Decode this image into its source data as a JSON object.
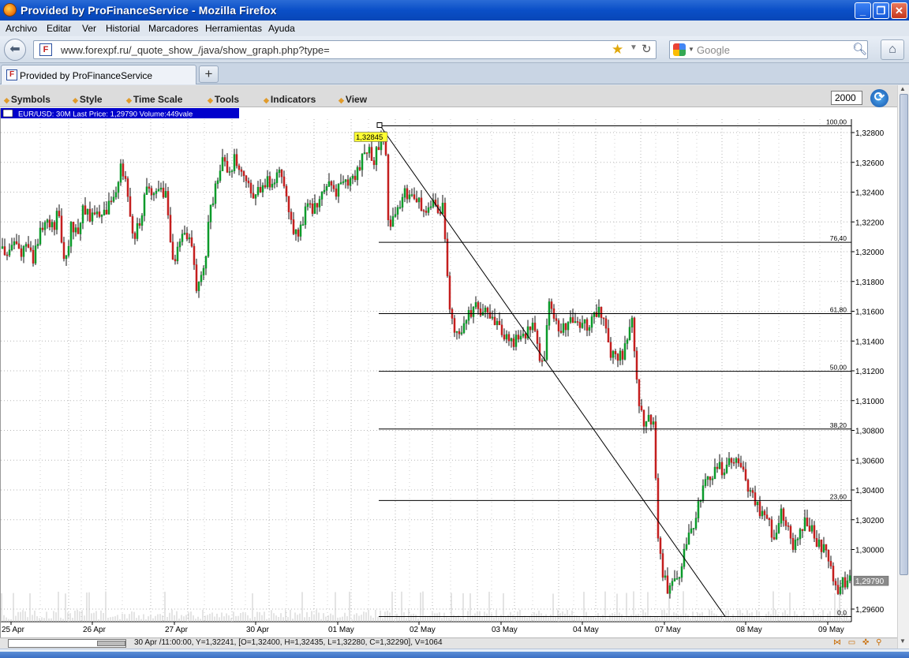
{
  "window": {
    "title": "Provided by ProFinanceService - Mozilla Firefox",
    "buttons": {
      "minimize": "_",
      "maximize": "❐",
      "close": "✕"
    }
  },
  "menubar": [
    "Archivo",
    "Editar",
    "Ver",
    "Historial",
    "Marcadores",
    "Herramientas",
    "Ayuda"
  ],
  "navbar": {
    "url": "www.forexpf.ru/_quote_show_/java/show_graph.php?type=",
    "search_placeholder": "Google",
    "site_icon_letter": "F"
  },
  "tabs": [
    {
      "label": "Provided by ProFinanceService",
      "icon": "F"
    }
  ],
  "newtab_label": "+",
  "toolbar": {
    "menus": [
      "Symbols",
      "Style",
      "Time Scale",
      "Tools",
      "Indicators",
      "View"
    ],
    "zoom_value": "2000"
  },
  "status": {
    "text": "30 Apr /11:00:00, Y=1,32241, [O=1,32400, H=1,32435, L=1,32280, C=1,32290], V=1064",
    "icons": "⋈ ▭ ✜ ⚲"
  },
  "chart_data": {
    "type": "candlestick",
    "header": "EUR/USD: 30M Last Price: 1,29790 Volume:449vale",
    "ylim": [
      1.295,
      1.329
    ],
    "y_ticks": [
      "1,32800",
      "1,32600",
      "1,32400",
      "1,32200",
      "1,32000",
      "1,31800",
      "1,31600",
      "1,31400",
      "1,31200",
      "1,31000",
      "1,30800",
      "1,30600",
      "1,30400",
      "1,30200",
      "1,30000",
      "1,29600"
    ],
    "x_ticks": [
      "25 Apr",
      "26 Apr",
      "27 Apr",
      "30 Apr",
      "01 May",
      "02 May",
      "03 May",
      "04 May",
      "07 May",
      "08 May",
      "09 May"
    ],
    "last_price": "1,29790",
    "high_marker": "1,32845",
    "fibonacci": {
      "high": 1.32845,
      "low": 1.2955,
      "levels": [
        {
          "label": "100,00",
          "price": 1.32845
        },
        {
          "label": "76,40",
          "price": 1.32063
        },
        {
          "label": "61,80",
          "price": 1.31584
        },
        {
          "label": "50,00",
          "price": 1.31197
        },
        {
          "label": "38,20",
          "price": 1.30809
        },
        {
          "label": "23,60",
          "price": 1.30329
        },
        {
          "label": "0,0",
          "price": 1.2955
        }
      ]
    },
    "trendline": {
      "from": {
        "date": "01 May",
        "price": 1.32845
      },
      "to": {
        "date": "08 May",
        "price": 1.2955
      }
    },
    "price_path": [
      [
        0,
        1.3202
      ],
      [
        8,
        1.3197
      ],
      [
        16,
        1.3205
      ],
      [
        24,
        1.3199
      ],
      [
        32,
        1.3201
      ],
      [
        40,
        1.3195
      ],
      [
        48,
        1.3212
      ],
      [
        56,
        1.3221
      ],
      [
        64,
        1.3215
      ],
      [
        72,
        1.3225
      ],
      [
        80,
        1.3192
      ],
      [
        88,
        1.3218
      ],
      [
        96,
        1.3213
      ],
      [
        104,
        1.3228
      ],
      [
        112,
        1.3224
      ],
      [
        120,
        1.3232
      ],
      [
        128,
        1.3221
      ],
      [
        136,
        1.3231
      ],
      [
        144,
        1.3237
      ],
      [
        152,
        1.3258
      ],
      [
        160,
        1.3236
      ],
      [
        168,
        1.3211
      ],
      [
        176,
        1.322
      ],
      [
        184,
        1.3244
      ],
      [
        192,
        1.3233
      ],
      [
        200,
        1.3247
      ],
      [
        208,
        1.3238
      ],
      [
        216,
        1.319
      ],
      [
        224,
        1.32
      ],
      [
        232,
        1.3212
      ],
      [
        240,
        1.3206
      ],
      [
        248,
        1.3172
      ],
      [
        256,
        1.3186
      ],
      [
        264,
        1.3226
      ],
      [
        272,
        1.3246
      ],
      [
        280,
        1.3262
      ],
      [
        288,
        1.3252
      ],
      [
        296,
        1.3266
      ],
      [
        304,
        1.3251
      ],
      [
        312,
        1.3246
      ],
      [
        320,
        1.3239
      ],
      [
        328,
        1.3241
      ],
      [
        336,
        1.3248
      ],
      [
        344,
        1.3245
      ],
      [
        352,
        1.3258
      ],
      [
        360,
        1.3237
      ],
      [
        368,
        1.3218
      ],
      [
        376,
        1.3209
      ],
      [
        384,
        1.3226
      ],
      [
        392,
        1.3229
      ],
      [
        400,
        1.3233
      ],
      [
        408,
        1.3241
      ],
      [
        416,
        1.3244
      ],
      [
        424,
        1.3239
      ],
      [
        432,
        1.3244
      ],
      [
        440,
        1.3246
      ],
      [
        448,
        1.3249
      ],
      [
        456,
        1.3262
      ],
      [
        464,
        1.3272
      ],
      [
        472,
        1.3262
      ],
      [
        480,
        1.3276
      ],
      [
        486,
        1.3282
      ],
      [
        490,
        1.3222
      ],
      [
        496,
        1.3219
      ],
      [
        504,
        1.3228
      ],
      [
        512,
        1.324
      ],
      [
        520,
        1.3239
      ],
      [
        528,
        1.3238
      ],
      [
        536,
        1.3222
      ],
      [
        544,
        1.3231
      ],
      [
        552,
        1.3228
      ],
      [
        560,
        1.3232
      ],
      [
        566,
        1.317
      ],
      [
        572,
        1.315
      ],
      [
        578,
        1.314
      ],
      [
        584,
        1.3145
      ],
      [
        592,
        1.3158
      ],
      [
        600,
        1.3165
      ],
      [
        608,
        1.316
      ],
      [
        616,
        1.3158
      ],
      [
        624,
        1.3152
      ],
      [
        632,
        1.3148
      ],
      [
        640,
        1.3143
      ],
      [
        648,
        1.314
      ],
      [
        656,
        1.3142
      ],
      [
        664,
        1.3144
      ],
      [
        672,
        1.3153
      ],
      [
        680,
        1.3132
      ],
      [
        688,
        1.3125
      ],
      [
        694,
        1.317
      ],
      [
        700,
        1.3152
      ],
      [
        708,
        1.315
      ],
      [
        716,
        1.3152
      ],
      [
        724,
        1.3151
      ],
      [
        732,
        1.3153
      ],
      [
        740,
        1.315
      ],
      [
        748,
        1.3155
      ],
      [
        756,
        1.3162
      ],
      [
        764,
        1.315
      ],
      [
        772,
        1.313
      ],
      [
        780,
        1.3128
      ],
      [
        788,
        1.3132
      ],
      [
        794,
        1.314
      ],
      [
        798,
        1.3165
      ],
      [
        802,
        1.313
      ],
      [
        808,
        1.3095
      ],
      [
        814,
        1.3085
      ],
      [
        820,
        1.309
      ],
      [
        826,
        1.3082
      ],
      [
        832,
        1.3012
      ],
      [
        838,
        1.298
      ],
      [
        844,
        1.2975
      ],
      [
        852,
        1.2978
      ],
      [
        860,
        1.2985
      ],
      [
        868,
        1.3005
      ],
      [
        876,
        1.3015
      ],
      [
        884,
        1.3035
      ],
      [
        892,
        1.3045
      ],
      [
        900,
        1.3052
      ],
      [
        908,
        1.3056
      ],
      [
        916,
        1.3052
      ],
      [
        924,
        1.3058
      ],
      [
        932,
        1.306
      ],
      [
        940,
        1.305
      ],
      [
        948,
        1.304
      ],
      [
        956,
        1.303
      ],
      [
        964,
        1.3025
      ],
      [
        972,
        1.3018
      ],
      [
        980,
        1.3005
      ],
      [
        988,
        1.3028
      ],
      [
        996,
        1.3018
      ],
      [
        1004,
        1.3002
      ],
      [
        1012,
        1.3015
      ],
      [
        1020,
        1.3022
      ],
      [
        1028,
        1.301
      ],
      [
        1036,
        1.3002
      ],
      [
        1044,
        1.2998
      ],
      [
        1052,
        1.2985
      ],
      [
        1060,
        1.2975
      ],
      [
        1068,
        1.2978
      ],
      [
        1074,
        1.2983
      ],
      [
        1078,
        1.2979
      ]
    ]
  }
}
